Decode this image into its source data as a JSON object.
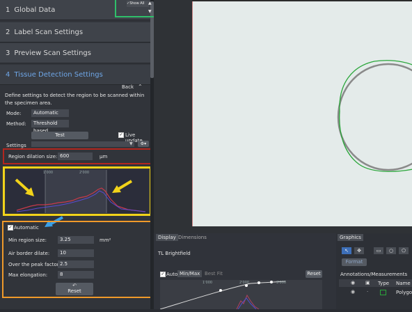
{
  "sections": [
    {
      "num": "1",
      "label": "Global Data"
    },
    {
      "num": "2",
      "label": "Label Scan Settings"
    },
    {
      "num": "3",
      "label": "Preview Scan Settings"
    },
    {
      "num": "4",
      "label": "Tissue Detection Settings"
    }
  ],
  "show_all": "Show All",
  "back_label": "Back",
  "description": "Define settings to detect the region to be scanned within the specimen area.",
  "mode": {
    "label": "Mode:",
    "value": "Automatic"
  },
  "method": {
    "label": "Method:",
    "value": "Threshold based"
  },
  "test_button": "Test",
  "live_update": "Live update",
  "settings_label": "Settings",
  "dilation": {
    "label": "Region dilation size:",
    "value": "600",
    "unit": "µm"
  },
  "histogram_ticks": [
    "1'000",
    "2'000"
  ],
  "automatic_label": "Automatic",
  "min_region": {
    "label": "Min region size:",
    "value": "3.25",
    "unit": "mm²"
  },
  "air_border": {
    "label": "Air border dilate:",
    "value": "10"
  },
  "peak_factor": {
    "label": "Over the peak factor:",
    "value": "2.5"
  },
  "max_elong": {
    "label": "Max elongation:",
    "value": "8"
  },
  "reset_label": "Reset",
  "display_tabs": [
    "Display",
    "Dimensions"
  ],
  "channel": "TL Brightfield",
  "auto_label": "Auto",
  "minmax_tabs": [
    "Min/Max",
    "Best Fit"
  ],
  "display_reset": "Reset",
  "display_ticks": [
    "1'000",
    "2'000",
    "3'000"
  ],
  "graphics_tab": "Graphics",
  "format_label": "Format",
  "annotations_label": "Annotations/Measurements",
  "table_headers": [
    "Type",
    "Name"
  ],
  "table_row_name": "Polygon",
  "colors": {
    "red": "#b3261e",
    "yellow": "#f2d31a",
    "orange": "#f09a2a",
    "green": "#2fbf6a",
    "blue": "#3aa0e8"
  }
}
